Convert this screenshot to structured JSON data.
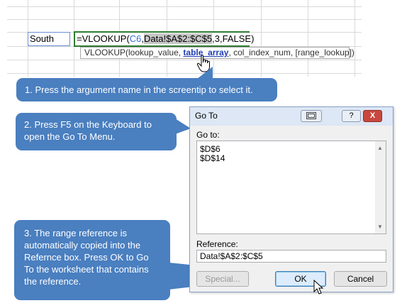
{
  "sheet": {
    "cell_value": "South",
    "formula": {
      "prefix": "=VLOOKUP(",
      "ref_c6": "C6",
      "comma1": ",",
      "table_ref": "Data!$A$2:$C$5",
      "rest": ",3,FALSE)"
    },
    "screentip": {
      "prefix": "VLOOKUP(lookup_value, ",
      "active_arg": "table_array",
      "rest": ", col_index_num, [range_lookup])"
    }
  },
  "callouts": {
    "step1": "1. Press the argument name in the screentip to select it.",
    "step2": "2. Press F5 on the Keyboard to open the Go To Menu.",
    "step3": "3. The range reference is automatically copied into the Refernce box.  Press OK to Go To the worksheet that contains the reference."
  },
  "dialog": {
    "title": "Go To",
    "help_label": "?",
    "close_label": "X",
    "goto_label": "Go to:",
    "goto_items": [
      "$D$6",
      "$D$14"
    ],
    "reference_label": "Reference:",
    "reference_value": "Data!$A$2:$C$5",
    "special_label": "Special...",
    "ok_label": "OK",
    "cancel_label": "Cancel"
  },
  "colors": {
    "callout": "#4a7fc0",
    "active_cell_border": "#2e7d32",
    "ref_blue": "#3b6fd6",
    "close_button": "#c9473e"
  },
  "icons": {
    "hand": "hand-pointer-icon",
    "cursor": "arrow-cursor-icon",
    "window_mode": "window-mode-icon"
  }
}
